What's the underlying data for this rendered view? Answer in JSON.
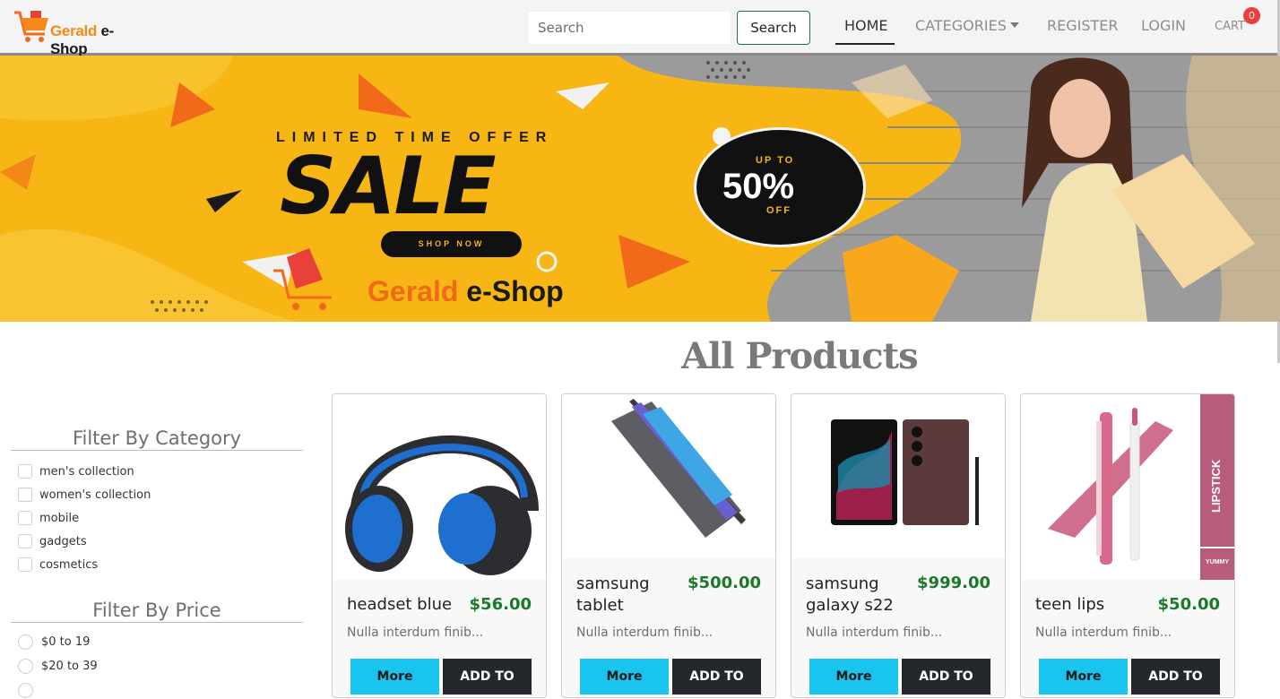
{
  "brand": {
    "logo_text_a": "Gerald",
    "logo_text_b": " e-Shop",
    "logo_icon": "cart-icon",
    "accent": "#f58a1a"
  },
  "search": {
    "placeholder": "Search",
    "button_label": "Search"
  },
  "nav": {
    "home": "HOME",
    "categories": "CATEGORIES",
    "register": "REGISTER",
    "login": "LOGIN",
    "cart": "CART",
    "cart_count": "0"
  },
  "banner": {
    "headline": "LIMITED TIME OFFER",
    "sale": "SALE",
    "cta": "SHOP NOW",
    "badge_top": "UP TO",
    "badge_value": "50%",
    "badge_bottom": "OFF",
    "brand_a": "Gerald",
    "brand_b": " e-Shop",
    "background_color": "#f7b614"
  },
  "main": {
    "title": "All Products"
  },
  "filters": {
    "category_title": "Filter By Category",
    "categories": [
      "men's collection",
      "women's collection",
      "mobile",
      "gadgets",
      "cosmetics"
    ],
    "price_title": "Filter By Price",
    "prices": [
      "$0 to 19",
      "$20 to 39"
    ]
  },
  "products": [
    {
      "name": "headset blue",
      "price": "$56.00",
      "desc": "Nulla interdum finib...",
      "more": "More",
      "add": "ADD TO",
      "image_icon": "headset-icon"
    },
    {
      "name": "samsung tablet",
      "price": "$500.00",
      "desc": "Nulla interdum finib...",
      "more": "More",
      "add": "ADD TO",
      "image_icon": "tablet-icon"
    },
    {
      "name": "samsung galaxy s22",
      "price": "$999.00",
      "desc": "Nulla interdum finib...",
      "more": "More",
      "add": "ADD TO",
      "image_icon": "phone-icon"
    },
    {
      "name": "teen lips",
      "price": "$50.00",
      "desc": "Nulla interdum finib...",
      "more": "More",
      "add": "ADD TO",
      "image_icon": "lipstick-icon",
      "box_text": "LIPSTICK",
      "box_sub": "YUMMY"
    }
  ],
  "colors": {
    "price": "#197a2a",
    "more_button": "#19c4ee",
    "add_button": "#24282c"
  }
}
